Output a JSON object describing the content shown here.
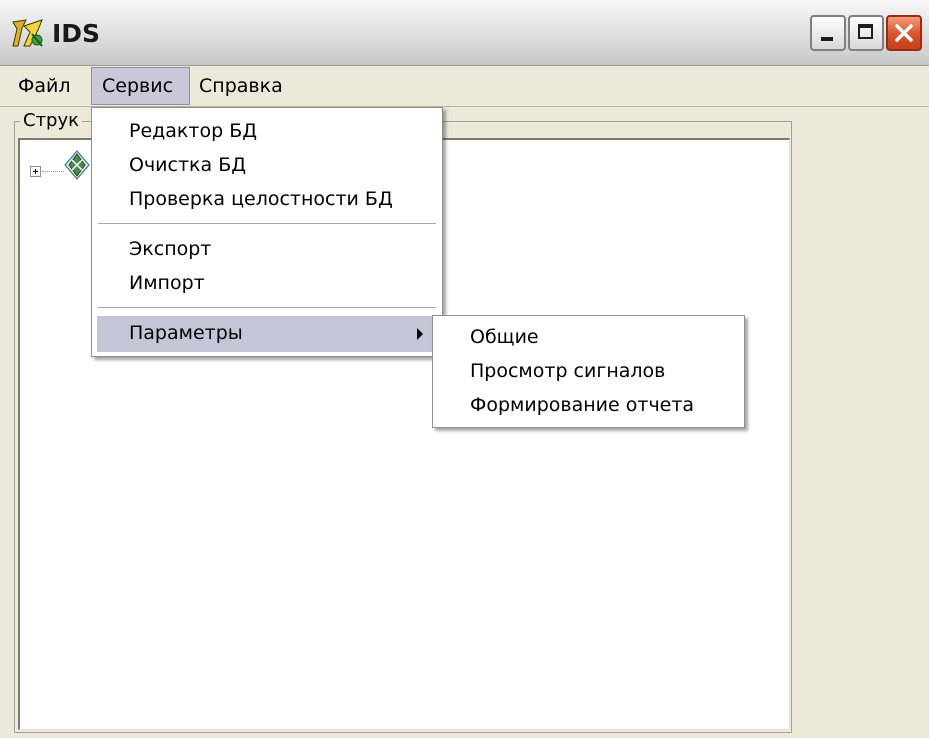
{
  "window": {
    "title": "IDS"
  },
  "menubar": {
    "items": [
      {
        "label": "Файл"
      },
      {
        "label": "Сервис"
      },
      {
        "label": "Справка"
      }
    ]
  },
  "groupbox": {
    "title": "Струк"
  },
  "service_menu": {
    "items": [
      {
        "label": "Редактор БД"
      },
      {
        "label": "Очистка БД"
      },
      {
        "label": "Проверка целостности БД"
      },
      {
        "label": "Экспорт"
      },
      {
        "label": "Импорт"
      },
      {
        "label": "Параметры"
      }
    ]
  },
  "params_submenu": {
    "items": [
      {
        "label": "Общие"
      },
      {
        "label": "Просмотр сигналов"
      },
      {
        "label": "Формирование отчета"
      }
    ]
  },
  "colors": {
    "menu_highlight": "#c4c5d6",
    "window_face": "#ece9d8",
    "close_button": "#d9532c"
  },
  "icons": {
    "app": "ids-app-icon",
    "tree_node": "database-node-icon",
    "submenu": "triangle-right-icon"
  }
}
